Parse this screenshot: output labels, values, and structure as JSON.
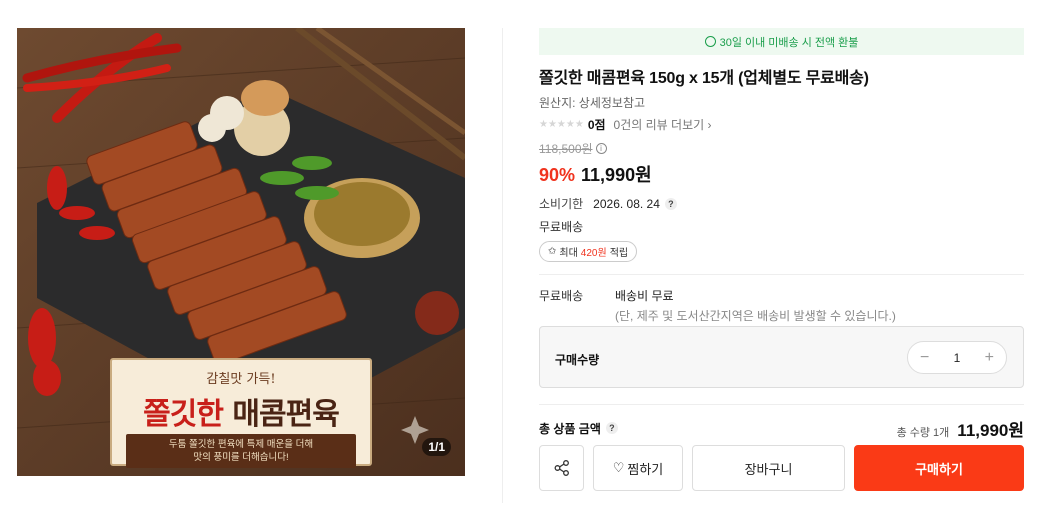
{
  "gallery": {
    "counter": "1/1",
    "banner_sub": "감칠맛 가득!",
    "banner_main_red": "쫄깃한",
    "banner_main_dark": "매콤편육",
    "banner_desc_1": "두툼 쫄깃한 편육에 특제 매운을 더해",
    "banner_desc_2": "맛의 풍미를 더해습니다!"
  },
  "notice": "30일 이내 미배송 시 전액 환불",
  "product": {
    "title": "쫄깃한 매콤편육 150g x 15개 (업체별도 무료배송)",
    "origin": "원산지: 상세정보참고",
    "stars": "★★★★★",
    "score": "0점",
    "reviews": "0건의 리뷰 더보기 ›",
    "original_price": "118,500원",
    "discount_rate": "90%",
    "price": "11,990원",
    "expiry_label": "소비기한",
    "expiry_value": "2026. 08. 24",
    "free_shipping": "무료배송",
    "points_prefix": "최대",
    "points_value": "420원",
    "points_suffix": "적립"
  },
  "shipping": {
    "label": "무료배송",
    "line1": "배송비 무료",
    "line2": "(단, 제주 및 도서산간지역은 배송비 발생할 수 있습니다.)"
  },
  "quantity": {
    "label": "구매수량",
    "minus": "−",
    "value": "1",
    "plus": "+"
  },
  "total": {
    "label": "총 상품 금액",
    "count": "총 수량 1개",
    "sum": "11,990원"
  },
  "actions": {
    "wish": "찜하기",
    "cart": "장바구니",
    "buy": "구매하기"
  },
  "colors": {
    "accent": "#fa3a16",
    "discount": "#f0331e",
    "notice_green": "#1a9e4b"
  }
}
